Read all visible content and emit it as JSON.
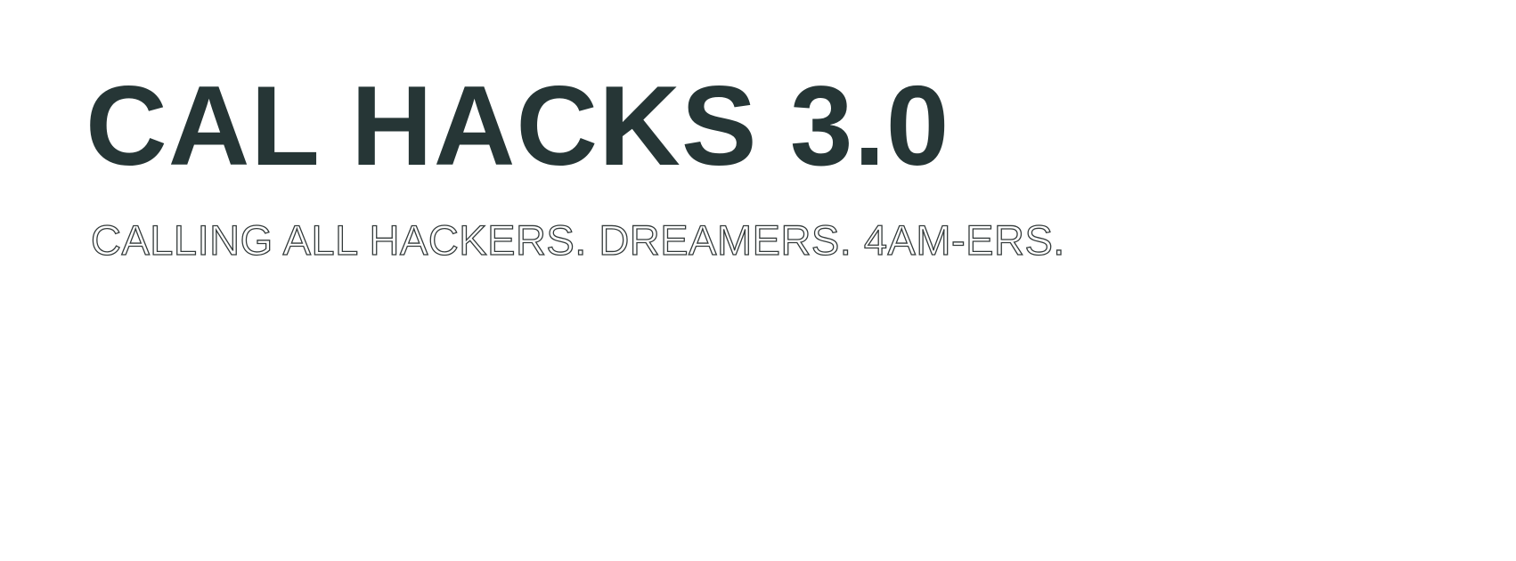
{
  "hero": {
    "title": "CAL HACKS 3.0",
    "tagline": "CALLING ALL HACKERS. DREAMERS. 4AM-ERS."
  },
  "colors": {
    "background": "#ffffff",
    "title": "#263636",
    "tagline": "#333a3a"
  }
}
